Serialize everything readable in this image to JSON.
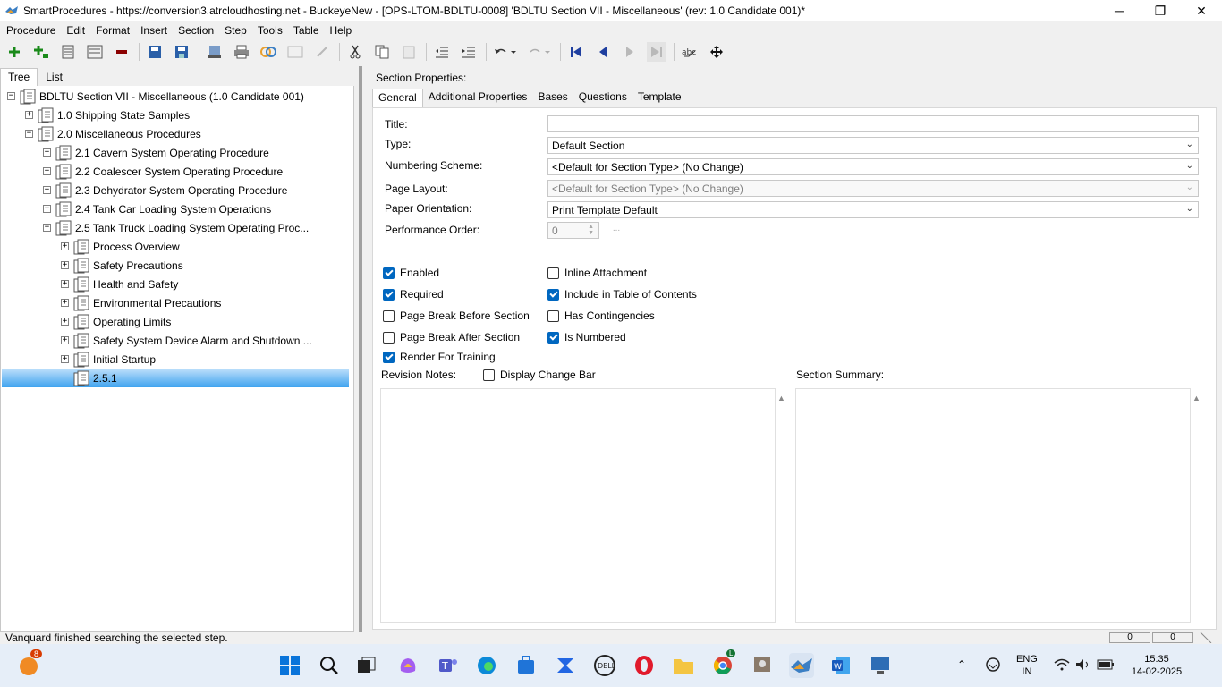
{
  "window": {
    "title": "SmartProcedures - https://conversion3.atrcloudhosting.net - BuckeyeNew - [OPS-LTOM-BDLTU-0008] 'BDLTU Section VII - Miscellaneous' (rev: 1.0 Candidate 001)*",
    "minimize": "─",
    "maximize": "❐",
    "close": "✕"
  },
  "menu": [
    "Procedure",
    "Edit",
    "Format",
    "Insert",
    "Section",
    "Step",
    "Tools",
    "Table",
    "Help"
  ],
  "left_tabs": [
    "Tree",
    "List"
  ],
  "tree": [
    {
      "label": "BDLTU Section VII - Miscellaneous (1.0 Candidate 001)",
      "level": 0,
      "exp": "−"
    },
    {
      "label": "1.0 Shipping State Samples",
      "level": 1,
      "exp": "+"
    },
    {
      "label": "2.0 Miscellaneous Procedures",
      "level": 1,
      "exp": "−"
    },
    {
      "label": "2.1 Cavern System Operating Procedure",
      "level": 2,
      "exp": "+"
    },
    {
      "label": "2.2 Coalescer System Operating Procedure",
      "level": 2,
      "exp": "+"
    },
    {
      "label": "2.3 Dehydrator System Operating Procedure",
      "level": 2,
      "exp": "+"
    },
    {
      "label": "2.4 Tank Car Loading System Operations",
      "level": 2,
      "exp": "+"
    },
    {
      "label": "2.5 Tank Truck Loading System Operating Proc...",
      "level": 2,
      "exp": "−"
    },
    {
      "label": "Process Overview",
      "level": 3,
      "exp": "+"
    },
    {
      "label": "Safety Precautions",
      "level": 3,
      "exp": "+"
    },
    {
      "label": "Health and Safety",
      "level": 3,
      "exp": "+"
    },
    {
      "label": "Environmental Precautions",
      "level": 3,
      "exp": "+"
    },
    {
      "label": "Operating Limits",
      "level": 3,
      "exp": "+"
    },
    {
      "label": "Safety System Device Alarm and Shutdown ...",
      "level": 3,
      "exp": "+"
    },
    {
      "label": "Initial Startup",
      "level": 3,
      "exp": "+"
    },
    {
      "label": "2.5.1",
      "level": 3,
      "exp": "",
      "selected": true
    }
  ],
  "section_properties_label": "Section Properties:",
  "right_tabs": [
    "General",
    "Additional Properties",
    "Bases",
    "Questions",
    "Template"
  ],
  "form": {
    "title_label": "Title:",
    "title_value": "",
    "type_label": "Type:",
    "type_value": "Default Section",
    "numbering_label": "Numbering Scheme:",
    "numbering_value": "<Default for Section Type> (No Change)",
    "page_layout_label": "Page Layout:",
    "page_layout_value": "<Default for Section Type> (No Change)",
    "orientation_label": "Paper Orientation:",
    "orientation_value": "Print Template Default",
    "perf_order_label": "Performance Order:",
    "perf_order_value": "0",
    "revision_notes_label": "Revision Notes:",
    "section_summary_label": "Section Summary:"
  },
  "checkboxes": {
    "enabled": {
      "label": "Enabled",
      "checked": true
    },
    "required": {
      "label": "Required",
      "checked": true
    },
    "page_break_before": {
      "label": "Page Break Before Section",
      "checked": false
    },
    "page_break_after": {
      "label": "Page Break After Section",
      "checked": false
    },
    "render_training": {
      "label": "Render For Training",
      "checked": true
    },
    "inline_attachment": {
      "label": "Inline Attachment",
      "checked": false
    },
    "include_toc": {
      "label": "Include in Table of Contents",
      "checked": true
    },
    "has_contingencies": {
      "label": "Has Contingencies",
      "checked": false
    },
    "is_numbered": {
      "label": "Is Numbered",
      "checked": true
    },
    "display_change_bar": {
      "label": "Display Change Bar",
      "checked": false
    }
  },
  "status": {
    "message": "Vanquard finished searching the selected step.",
    "box1": "0",
    "box2": "0"
  },
  "taskbar": {
    "notification_badge": "8",
    "chrome_badge": "L",
    "lang_line1": "ENG",
    "lang_line2": "IN",
    "time": "15:35",
    "date": "14-02-2025"
  },
  "colors": {
    "selection": "#3fa3ef",
    "checkbox": "#0067c0",
    "taskbar": "#e6eef8"
  }
}
